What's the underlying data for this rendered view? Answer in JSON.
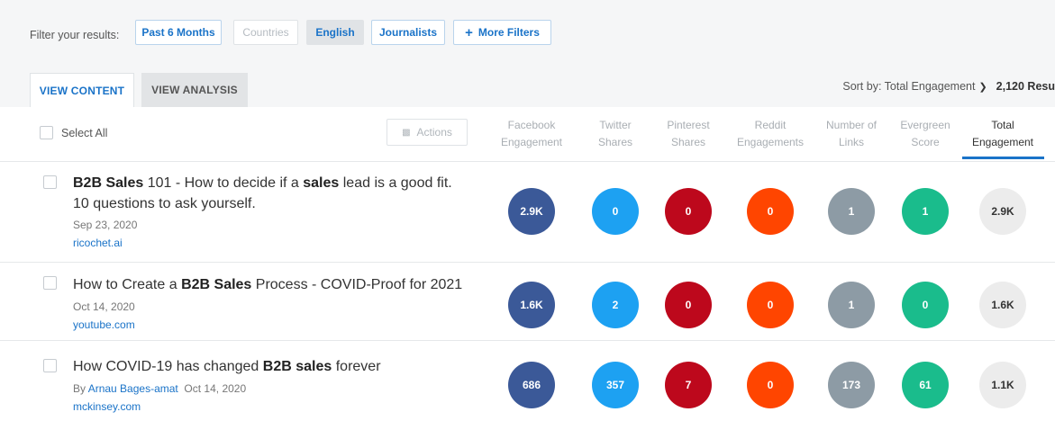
{
  "filters": {
    "label": "Filter your results:",
    "buttons": [
      {
        "label": "Past 6 Months"
      },
      {
        "label": "Countries"
      },
      {
        "label": "English"
      },
      {
        "label": "Journalists"
      },
      {
        "label": "More Filters"
      }
    ]
  },
  "tabs": [
    {
      "label": "VIEW CONTENT"
    },
    {
      "label": "VIEW ANALYSIS"
    }
  ],
  "sort": {
    "label": "Sort by: Total Engagement",
    "count": "2,120 Resu"
  },
  "table": {
    "select_all": "Select All",
    "actions": "Actions",
    "columns": [
      {
        "line1": "Facebook",
        "line2": "Engagement"
      },
      {
        "line1": "Twitter",
        "line2": "Shares"
      },
      {
        "line1": "Pinterest",
        "line2": "Shares"
      },
      {
        "line1": "Reddit",
        "line2": "Engagements"
      },
      {
        "line1": "Number of",
        "line2": "Links"
      },
      {
        "line1": "Evergreen",
        "line2": "Score"
      },
      {
        "line1": "Total",
        "line2": "Engagement"
      }
    ]
  },
  "rows": [
    {
      "title_parts": [
        {
          "text": "B2B Sales",
          "bold": true
        },
        {
          "text": " 101 - How to decide if a ",
          "bold": false
        },
        {
          "text": "sales",
          "bold": true
        },
        {
          "text": " lead is a good fit. 10 questions to ask yourself.",
          "bold": false
        }
      ],
      "by": "",
      "author": "",
      "date": "Sep 23, 2020",
      "domain": "ricochet.ai",
      "metrics": [
        "2.9K",
        "0",
        "0",
        "0",
        "1",
        "1",
        "2.9K"
      ]
    },
    {
      "title_parts": [
        {
          "text": "How to Create a ",
          "bold": false
        },
        {
          "text": "B2B Sales",
          "bold": true
        },
        {
          "text": " Process - COVID-Proof for 2021",
          "bold": false
        }
      ],
      "by": "",
      "author": "",
      "date": "Oct 14, 2020",
      "domain": "youtube.com",
      "metrics": [
        "1.6K",
        "2",
        "0",
        "0",
        "1",
        "0",
        "1.6K"
      ]
    },
    {
      "title_parts": [
        {
          "text": "How COVID-19 has changed ",
          "bold": false
        },
        {
          "text": "B2B sales",
          "bold": true
        },
        {
          "text": " forever",
          "bold": false
        }
      ],
      "by": "By",
      "author": "Arnau Bages-amat",
      "date": "Oct 14, 2020",
      "domain": "mckinsey.com",
      "metrics": [
        "686",
        "357",
        "7",
        "0",
        "173",
        "61",
        "1.1K"
      ]
    }
  ],
  "colors": {
    "accent": "#1a73c8",
    "facebook": "#3b5998",
    "twitter": "#1da1f2",
    "pinterest": "#bd081c",
    "reddit": "#ff4500",
    "links": "#8d9ba5",
    "evergreen": "#1abc8c",
    "total": "#ececec"
  }
}
